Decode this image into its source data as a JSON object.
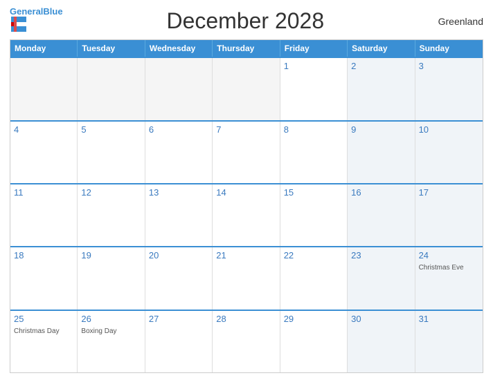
{
  "header": {
    "logo_general": "General",
    "logo_blue": "Blue",
    "title": "December 2028",
    "region": "Greenland"
  },
  "days_of_week": [
    "Monday",
    "Tuesday",
    "Wednesday",
    "Thursday",
    "Friday",
    "Saturday",
    "Sunday"
  ],
  "weeks": [
    [
      {
        "day": "",
        "event": "",
        "empty": true
      },
      {
        "day": "",
        "event": "",
        "empty": true
      },
      {
        "day": "",
        "event": "",
        "empty": true
      },
      {
        "day": "",
        "event": "",
        "empty": true
      },
      {
        "day": "1",
        "event": ""
      },
      {
        "day": "2",
        "event": ""
      },
      {
        "day": "3",
        "event": ""
      }
    ],
    [
      {
        "day": "4",
        "event": ""
      },
      {
        "day": "5",
        "event": ""
      },
      {
        "day": "6",
        "event": ""
      },
      {
        "day": "7",
        "event": ""
      },
      {
        "day": "8",
        "event": ""
      },
      {
        "day": "9",
        "event": ""
      },
      {
        "day": "10",
        "event": ""
      }
    ],
    [
      {
        "day": "11",
        "event": ""
      },
      {
        "day": "12",
        "event": ""
      },
      {
        "day": "13",
        "event": ""
      },
      {
        "day": "14",
        "event": ""
      },
      {
        "day": "15",
        "event": ""
      },
      {
        "day": "16",
        "event": ""
      },
      {
        "day": "17",
        "event": ""
      }
    ],
    [
      {
        "day": "18",
        "event": ""
      },
      {
        "day": "19",
        "event": ""
      },
      {
        "day": "20",
        "event": ""
      },
      {
        "day": "21",
        "event": ""
      },
      {
        "day": "22",
        "event": ""
      },
      {
        "day": "23",
        "event": ""
      },
      {
        "day": "24",
        "event": "Christmas Eve"
      }
    ],
    [
      {
        "day": "25",
        "event": "Christmas Day"
      },
      {
        "day": "26",
        "event": "Boxing Day"
      },
      {
        "day": "27",
        "event": ""
      },
      {
        "day": "28",
        "event": ""
      },
      {
        "day": "29",
        "event": ""
      },
      {
        "day": "30",
        "event": ""
      },
      {
        "day": "31",
        "event": ""
      }
    ]
  ]
}
